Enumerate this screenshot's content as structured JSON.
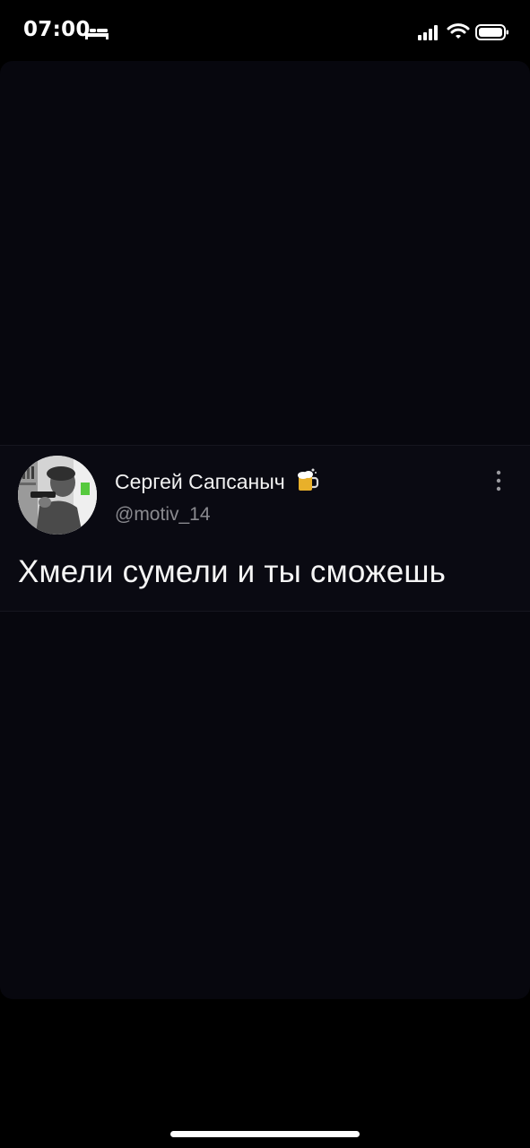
{
  "status_bar": {
    "time": "07:00",
    "icons": [
      "bed-icon",
      "signal-icon",
      "wifi-icon",
      "battery-icon"
    ]
  },
  "tweet": {
    "display_name": "Сергей Сапсаныч",
    "handle": "@motiv_14",
    "text": "Хмели сумели и ты сможешь",
    "icons": [
      "avatar-photo",
      "beer-mug-icon",
      "more-options-icon"
    ]
  },
  "colors": {
    "background": "#000000",
    "screen": "#07070e",
    "tweet_card": "#0a0a12",
    "text_primary": "#f5f5f5",
    "text_secondary": "#8a8a8f"
  }
}
